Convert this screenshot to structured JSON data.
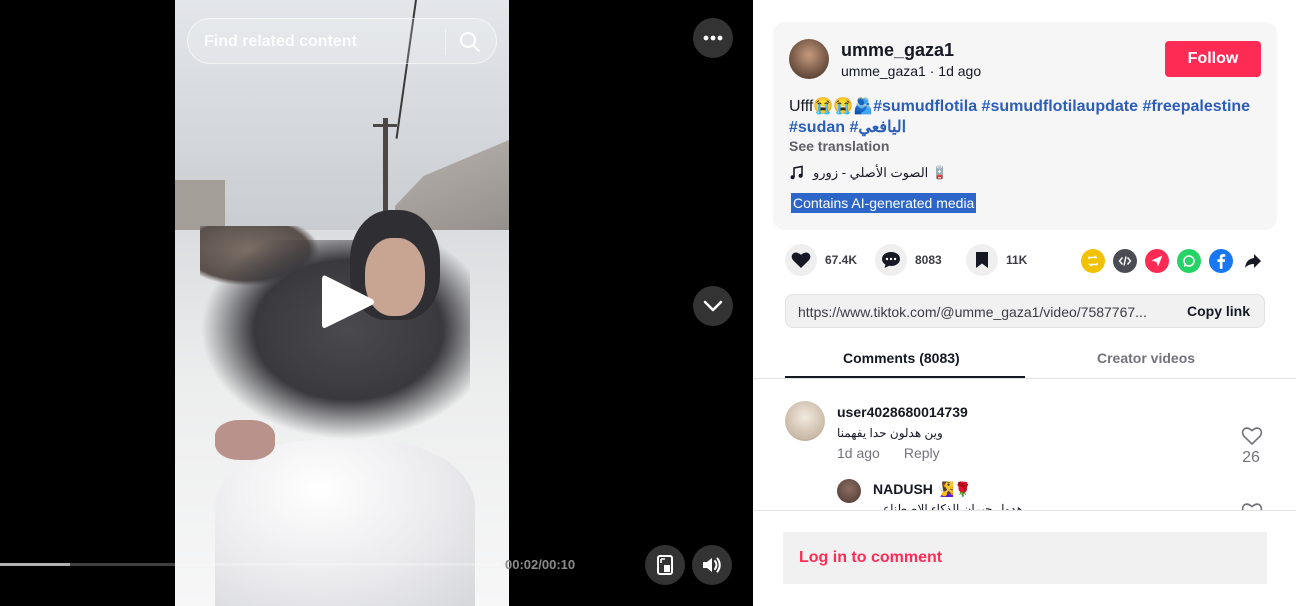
{
  "search": {
    "placeholder": "Find related content"
  },
  "player": {
    "time": "00:02/00:10",
    "progress": 0.14
  },
  "author": {
    "username": "umme_gaza1",
    "handle": "umme_gaza1",
    "posted": "1d ago",
    "follow_label": "Follow"
  },
  "post": {
    "caption_prefix": "Ufff😭😭🫂",
    "hashtags": [
      "#sumudflotila",
      "#sumudflotilaupdate",
      "#freepalestine",
      "#sudan",
      "#اليافعي"
    ],
    "see_translation": "See translation",
    "music": "الصوت الأصلي - زورو 🪫",
    "ai_label": "Contains AI-generated media"
  },
  "actions": {
    "likes": "67.4K",
    "comments": "8083",
    "saves": "11K"
  },
  "share": {
    "link": "https://www.tiktok.com/@umme_gaza1/video/7587767...",
    "copy_label": "Copy link"
  },
  "tabs": {
    "comments": "Comments (8083)",
    "creator": "Creator videos"
  },
  "comments": [
    {
      "user": "user4028680014739",
      "text": "وين هدلون حدا يفهمنا",
      "time": "1d ago",
      "reply": "Reply",
      "likes": "26"
    },
    {
      "user": "NADUSH 🧏‍♀️🌹",
      "text": "هدول جيران الذكاء الاصطناعي"
    }
  ],
  "footer": {
    "login_label": "Log in to comment"
  },
  "colors": {
    "accent": "#fe2c55",
    "hashtag": "#2b5db9",
    "ai_label_bg": "#2d66c8"
  }
}
